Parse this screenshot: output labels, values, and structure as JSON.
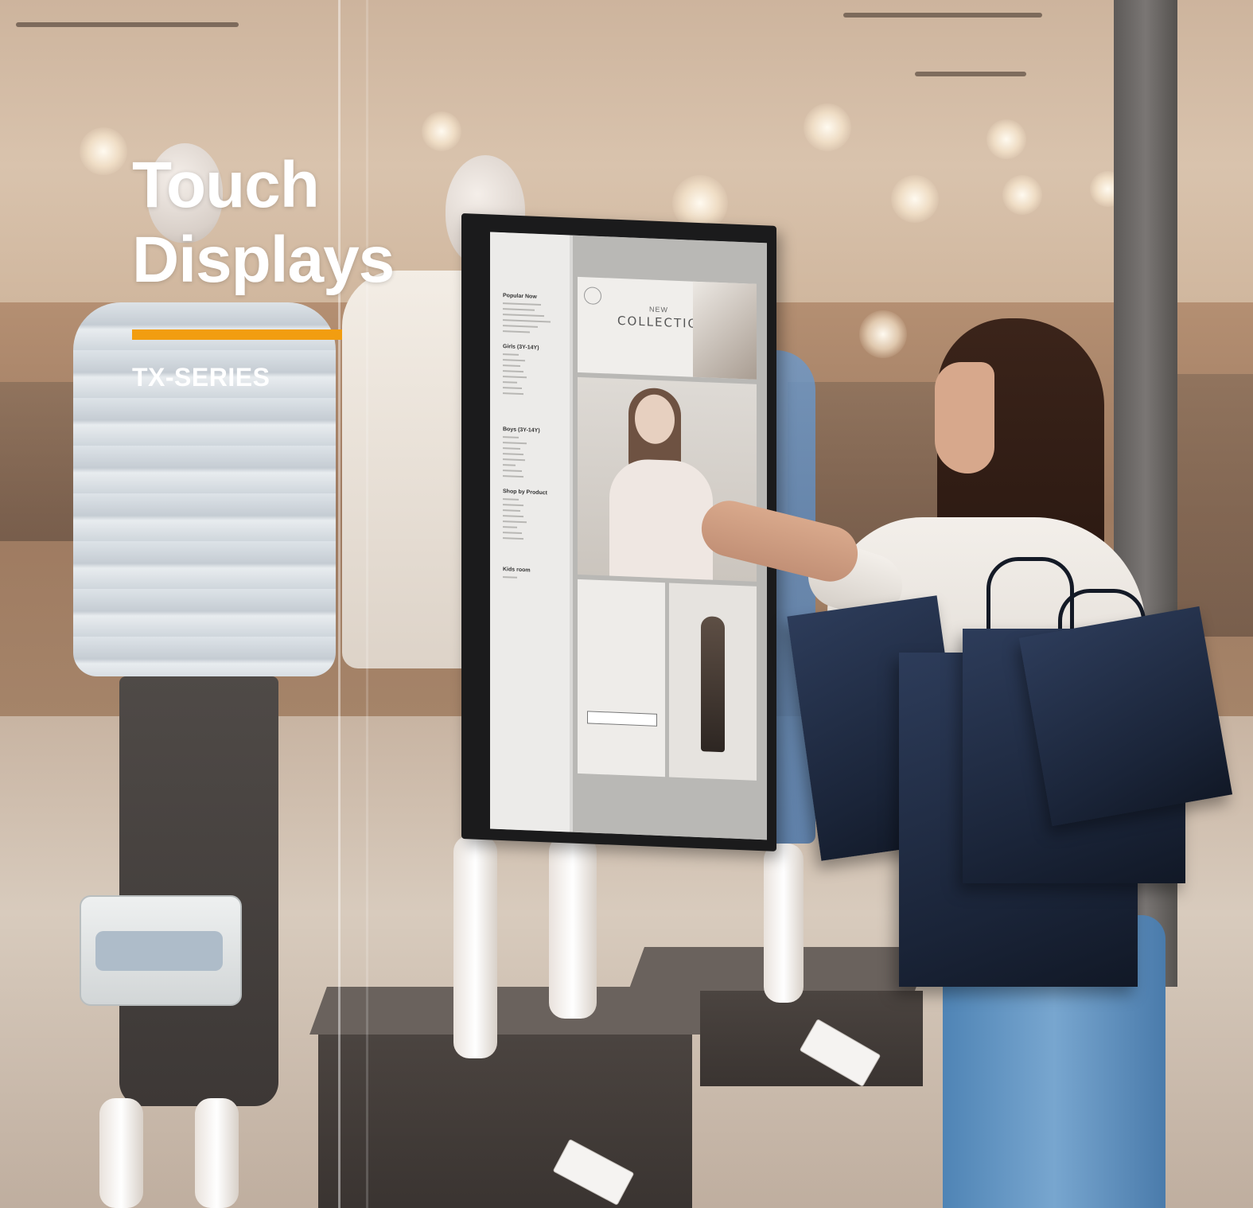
{
  "headline": {
    "line1": "Touch",
    "line2": "Displays"
  },
  "series": "TX-SERIES",
  "screen": {
    "sidebar_sections": [
      "Popular Now",
      "Girls (3Y-14Y)",
      "Boys (3Y-14Y)",
      "Shop by Product",
      "Kids room"
    ],
    "hero_new": "NEW",
    "hero_collection": "COLLECTION"
  },
  "colors": {
    "accent": "#f29d10",
    "headline_text": "#ffffff",
    "display_bezel": "#1b1b1c"
  }
}
